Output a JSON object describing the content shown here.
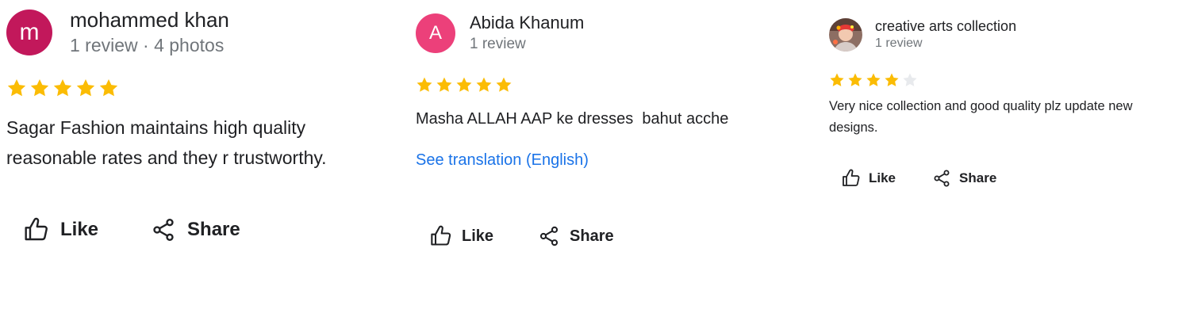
{
  "colors": {
    "star_filled": "#fbbc04",
    "star_empty": "#e8eaed",
    "link": "#1a73e8",
    "meta_text": "#70757a",
    "primary_text": "#202124"
  },
  "reviews": [
    {
      "avatar": {
        "letter": "m",
        "color": "#c2185b"
      },
      "author": "mohammed khan",
      "meta": "1 review · 4 photos",
      "rating": 5,
      "text": "Sagar Fashion maintains high quality reasonable rates and they r trustworthy.",
      "like_label": "Like",
      "share_label": "Share"
    },
    {
      "avatar": {
        "letter": "A",
        "color": "#ec407a"
      },
      "author": "Abida Khanum",
      "meta": "1 review",
      "rating": 5,
      "text": "Masha ALLAH AAP ke dresses  bahut acche",
      "translate_label": "See translation (English)",
      "like_label": "Like",
      "share_label": "Share"
    },
    {
      "avatar": {
        "image": "profile-photo"
      },
      "author": "creative arts collection",
      "meta": "1 review",
      "rating": 4,
      "text": "Very nice collection and good quality plz update new designs.",
      "like_label": "Like",
      "share_label": "Share"
    }
  ]
}
